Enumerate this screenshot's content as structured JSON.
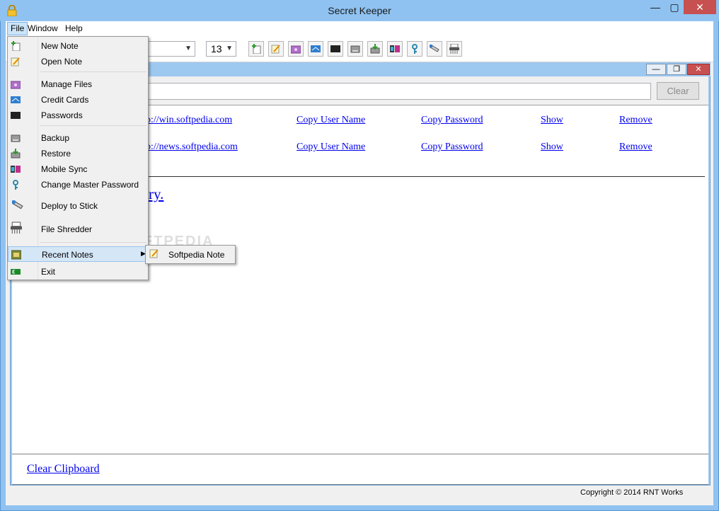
{
  "window": {
    "title": "Secret Keeper",
    "controls": {
      "minimize": "—",
      "maximize": "▢",
      "close": "✕"
    }
  },
  "menubar": {
    "file": "File",
    "window": "Window",
    "help": "Help"
  },
  "toolbar": {
    "font_value": "",
    "size_value": "13",
    "buttons": [
      "new-note",
      "open-note",
      "manage-files",
      "credit-cards",
      "passwords",
      "backup",
      "restore",
      "mobile-sync",
      "change-master-password",
      "deploy-to-stick",
      "file-shredder"
    ]
  },
  "child_window": {
    "controls": {
      "minimize": "—",
      "restore": "❐",
      "close": "✕"
    },
    "search": {
      "value": "",
      "placeholder": ""
    },
    "clear_label": "Clear",
    "passwords": [
      {
        "url": "p://win.softpedia.com",
        "copy_user": "Copy User Name",
        "copy_password": "Copy Password",
        "show": "Show",
        "remove": "Remove"
      },
      {
        "url": "p://news.softpedia.com",
        "copy_user": "Copy User Name",
        "copy_password": "Copy Password",
        "show": "Show",
        "remove": "Remove"
      }
    ],
    "note_title": "ry.",
    "clear_clipboard": "Clear Clipboard"
  },
  "status": {
    "copyright": "Copyright © 2014 RNT Works"
  },
  "file_menu": {
    "items": [
      {
        "label": "New Note",
        "icon": "new-note-icon"
      },
      {
        "label": "Open Note",
        "icon": "open-note-icon"
      },
      {
        "label": "Manage Files",
        "icon": "folder-icon"
      },
      {
        "label": "Credit Cards",
        "icon": "credit-card-icon"
      },
      {
        "label": "Passwords",
        "icon": "password-icon"
      },
      {
        "label": "Backup",
        "icon": "backup-icon"
      },
      {
        "label": "Restore",
        "icon": "restore-icon"
      },
      {
        "label": "Mobile Sync",
        "icon": "mobile-sync-icon"
      },
      {
        "label": "Change Master Password",
        "icon": "key-icon"
      },
      {
        "label": "Deploy to Stick",
        "icon": "usb-stick-icon"
      },
      {
        "label": "File Shredder",
        "icon": "shredder-icon"
      },
      {
        "label": "Recent Notes",
        "icon": "recent-notes-icon"
      },
      {
        "label": "Exit",
        "icon": "exit-icon"
      }
    ],
    "submenu": {
      "label": "Softpedia Note"
    }
  },
  "watermark": "SOFTPEDIA",
  "colors": {
    "titlebar": "#8fc2f0",
    "close": "#c75050",
    "link": "#0000ee",
    "menu_highlight": "#d5e6f7"
  }
}
